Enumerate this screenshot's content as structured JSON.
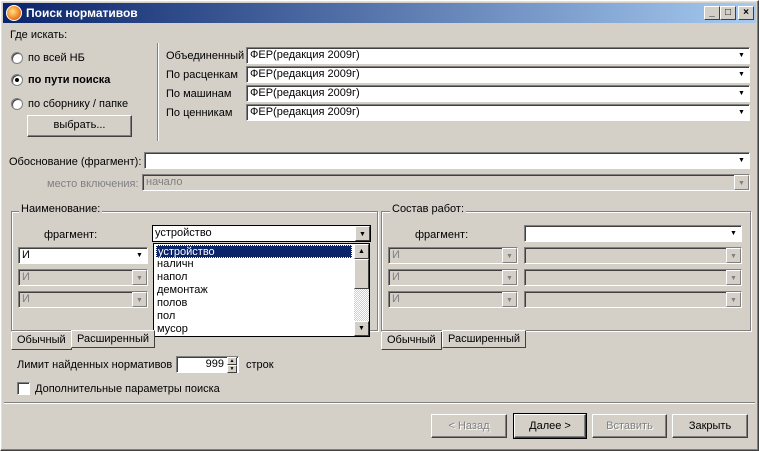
{
  "window": {
    "title": "Поиск нормативов"
  },
  "where": {
    "label": "Где искать:",
    "options": [
      "по всей НБ",
      "по пути поиска",
      "по сборнику / папке"
    ],
    "selected_index": 1,
    "choose_button": "выбрать..."
  },
  "bases": [
    {
      "label": "Объединенный",
      "value": "ФЕР(редакция 2009г)"
    },
    {
      "label": "По расценкам",
      "value": "ФЕР(редакция 2009г)"
    },
    {
      "label": "По машинам",
      "value": "ФЕР(редакция 2009г)"
    },
    {
      "label": "По ценникам",
      "value": "ФЕР(редакция 2009г)"
    }
  ],
  "basis": {
    "label": "Обоснование (фрагмент):",
    "value": ""
  },
  "place": {
    "label": "место включения:",
    "value": "начало"
  },
  "name_group": {
    "title": "Наименование:",
    "fragment_label": "фрагмент:",
    "fragment_value": "устройство",
    "logic_ops": [
      "И",
      "И",
      "И"
    ],
    "dropdown_items": [
      "устройство",
      "наличн",
      "напол",
      "демонтаж",
      "полов",
      "пол",
      "мусор"
    ],
    "tabs": [
      "Обычный",
      "Расширенный"
    ]
  },
  "works_group": {
    "title": "Состав работ:",
    "fragment_label": "фрагмент:",
    "fragment_value": "",
    "logic_ops": [
      "И",
      "И",
      "И"
    ],
    "tabs": [
      "Обычный",
      "Расширенный"
    ]
  },
  "limit": {
    "label": "Лимит найденных нормативов",
    "value": "999",
    "unit": "строк"
  },
  "extra": {
    "label": "Дополнительные параметры поиска",
    "checked": false
  },
  "buttons": {
    "back": "< Назад",
    "next": "Далее >",
    "insert": "Вставить",
    "close": "Закрыть"
  }
}
